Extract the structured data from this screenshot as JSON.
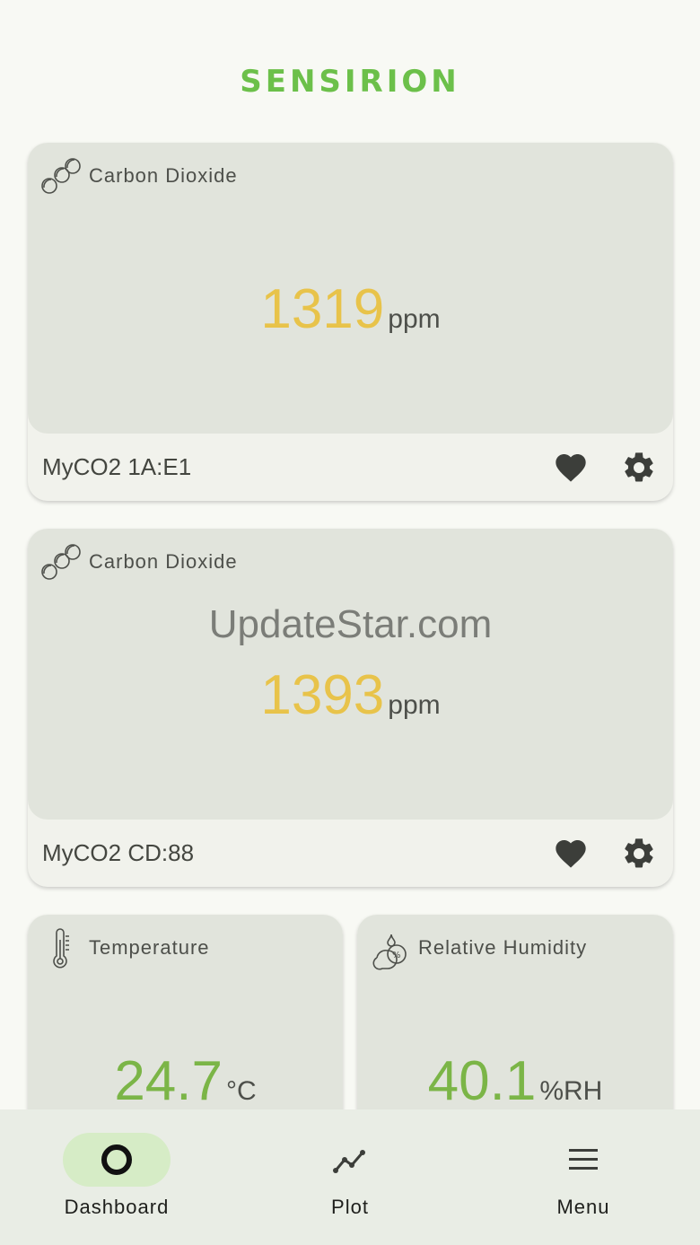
{
  "brand": "SENSIRION",
  "watermark": "UpdateStar.com",
  "cards": [
    {
      "title": "Carbon Dioxide",
      "value": "1319",
      "unit": "ppm",
      "device": "MyCO2 1A:E1"
    },
    {
      "title": "Carbon Dioxide",
      "value": "1393",
      "unit": "ppm",
      "device": "MyCO2 CD:88"
    },
    {
      "title": "Temperature",
      "value": "24.7",
      "unit": "°C"
    },
    {
      "title": "Relative Humidity",
      "value": "40.1",
      "unit": "%RH"
    }
  ],
  "nav": [
    {
      "label": "Dashboard",
      "icon": "ring-icon",
      "active": true
    },
    {
      "label": "Plot",
      "icon": "line-chart-icon"
    },
    {
      "label": "Menu",
      "icon": "hamburger-icon"
    }
  ],
  "colors": {
    "brand": "#6cc04a",
    "co2_value": "#e8c34a",
    "climate_value": "#7bb547",
    "card_top": "#e1e4dc",
    "nav_active": "#d6ecc6"
  }
}
